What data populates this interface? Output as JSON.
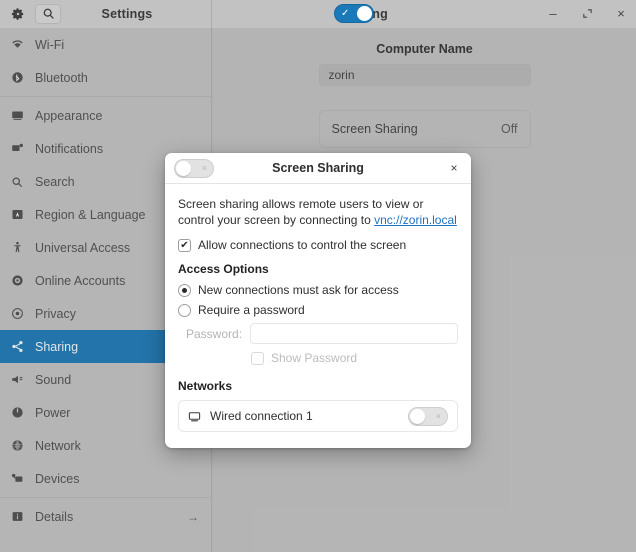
{
  "window": {
    "sidebar_title": "Settings",
    "title": "Sharing",
    "gear_icon": "gear-icon",
    "search_icon": "search-icon",
    "minimize_label": "–",
    "maximize_label": "⤡",
    "close_label": "×",
    "header_toggle_state": "on",
    "header_toggle_mark": "✓"
  },
  "colors": {
    "accent": "#1a74b0",
    "header_toggle": "#1a79b8",
    "link": "#1f72c0",
    "window_bg": "#bcbcbc",
    "sidebar_bg": "#bdbdbd",
    "titlebar_bg": "#c2c2c2",
    "dialog_bg": "#ffffff"
  },
  "sidebar": {
    "items": [
      {
        "label": "Wi-Fi",
        "icon": "wifi-icon",
        "active": false
      },
      {
        "label": "Bluetooth",
        "icon": "bluetooth-icon",
        "active": false
      },
      {
        "label": "Appearance",
        "icon": "appearance-icon",
        "active": false
      },
      {
        "label": "Notifications",
        "icon": "notifications-icon",
        "active": false
      },
      {
        "label": "Search",
        "icon": "search-icon",
        "active": false
      },
      {
        "label": "Region & Language",
        "icon": "region-language-icon",
        "active": false
      },
      {
        "label": "Universal Access",
        "icon": "universal-access-icon",
        "active": false
      },
      {
        "label": "Online Accounts",
        "icon": "online-accounts-icon",
        "active": false
      },
      {
        "label": "Privacy",
        "icon": "privacy-icon",
        "active": false
      },
      {
        "label": "Sharing",
        "icon": "sharing-icon",
        "active": true
      },
      {
        "label": "Sound",
        "icon": "sound-icon",
        "active": false
      },
      {
        "label": "Power",
        "icon": "power-icon",
        "active": false
      },
      {
        "label": "Network",
        "icon": "network-icon",
        "active": false
      },
      {
        "label": "Devices",
        "icon": "devices-icon",
        "active": false
      },
      {
        "label": "Details",
        "icon": "details-icon",
        "active": false,
        "arrow": "→"
      }
    ]
  },
  "main": {
    "computer_name_label": "Computer Name",
    "computer_name_value": "zorin",
    "rows": [
      {
        "label": "Screen Sharing",
        "value": "Off"
      }
    ]
  },
  "dialog": {
    "title": "Screen Sharing",
    "close_label": "×",
    "toggle_state": "off",
    "toggle_mark": "×",
    "description_prefix": "Screen sharing allows remote users to view or control your screen by connecting to ",
    "description_link": "vnc://zorin.local",
    "allow_control": {
      "label": "Allow connections to control the screen",
      "checked": true,
      "check_mark": "✔"
    },
    "access_options": {
      "title": "Access Options",
      "options": [
        {
          "label": "New connections must ask for access",
          "selected": true
        },
        {
          "label": "Require a password",
          "selected": false
        }
      ],
      "password_label": "Password:",
      "password_value": "",
      "password_placeholder": "",
      "show_password_label": "Show Password",
      "show_password_checked": false
    },
    "networks": {
      "title": "Networks",
      "items": [
        {
          "label": "Wired connection 1",
          "icon": "wired-network-icon",
          "toggle_state": "off",
          "toggle_mark": "×"
        }
      ]
    }
  }
}
